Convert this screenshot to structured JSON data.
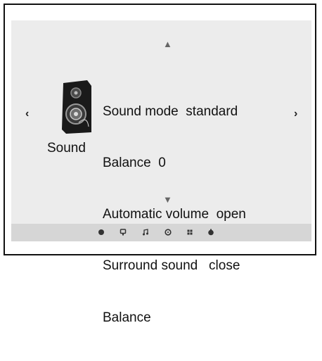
{
  "nav": {
    "up": "▲",
    "down": "▼",
    "left": "‹",
    "right": "›"
  },
  "category": {
    "label": "Sound",
    "icon": "speaker-icon"
  },
  "menu": {
    "items": [
      "Sound mode  standard",
      "Balance  0",
      "Automatic volume  open",
      "Surround sound   close",
      "Balance"
    ]
  },
  "bottom_bar": {
    "icons": [
      "picture-icon",
      "tv-icon",
      "music-icon",
      "clock-icon",
      "grid-icon",
      "lock-icon"
    ]
  },
  "colors": {
    "panel": "#ececec",
    "bar": "#d6d6d6",
    "frame": "#111111"
  }
}
